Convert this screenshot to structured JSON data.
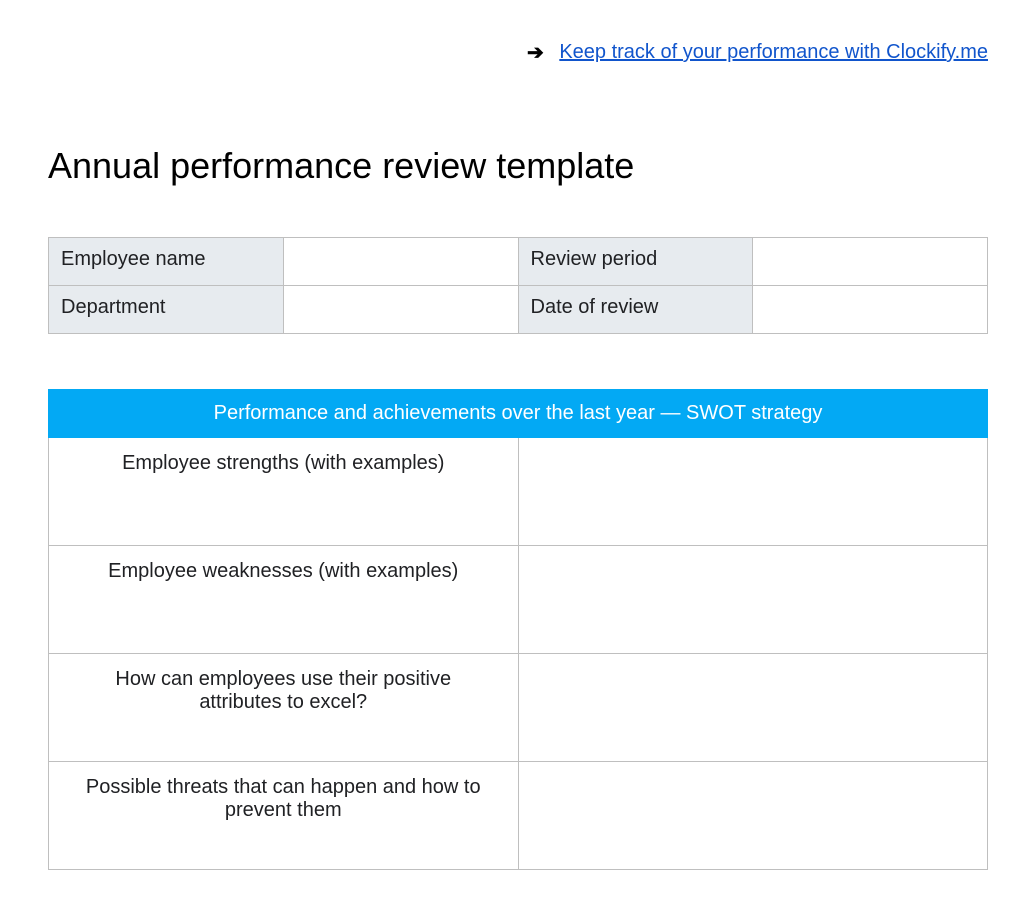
{
  "topLink": {
    "text": "Keep track of your performance with Clockify.me"
  },
  "title": "Annual performance review template",
  "info": {
    "rows": [
      {
        "label1": "Employee name",
        "value1": "",
        "label2": "Review period",
        "value2": ""
      },
      {
        "label1": "Department",
        "value1": "",
        "label2": "Date of review",
        "value2": ""
      }
    ]
  },
  "swot": {
    "header": "Performance and achievements over the last year — SWOT strategy",
    "rows": [
      {
        "label": "Employee strengths (with examples)",
        "answer": ""
      },
      {
        "label": "Employee weaknesses (with examples)",
        "answer": ""
      },
      {
        "label": "How can employees use their positive attributes to excel?",
        "answer": ""
      },
      {
        "label": "Possible threats that can happen and how to prevent them",
        "answer": ""
      }
    ]
  }
}
